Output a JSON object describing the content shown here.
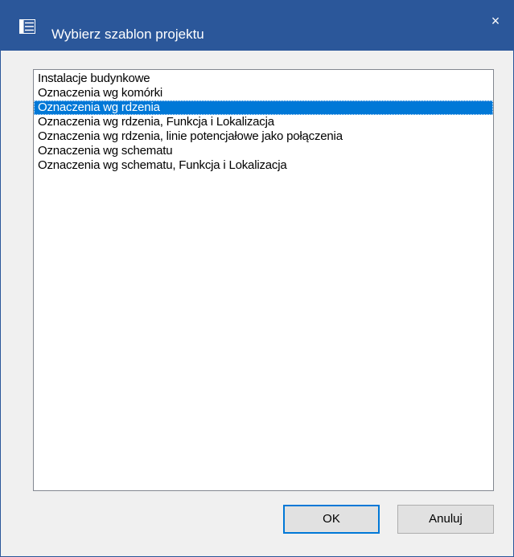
{
  "window": {
    "title": "Wybierz szablon projektu",
    "close_glyph": "×",
    "title_icon": "list-icon",
    "accent_color": "#2b579a",
    "selection_color": "#0078d7"
  },
  "templates": {
    "items": [
      "Instalacje budynkowe",
      "Oznaczenia wg komórki",
      "Oznaczenia wg rdzenia",
      "Oznaczenia wg rdzenia, Funkcja i Lokalizacja",
      "Oznaczenia wg rdzenia, linie potencjałowe jako połączenia",
      "Oznaczenia wg schematu",
      "Oznaczenia wg schematu, Funkcja i Lokalizacja"
    ],
    "selected": "Oznaczenia wg rdzenia"
  },
  "buttons": {
    "ok_label": "OK",
    "cancel_label": "Anuluj"
  }
}
